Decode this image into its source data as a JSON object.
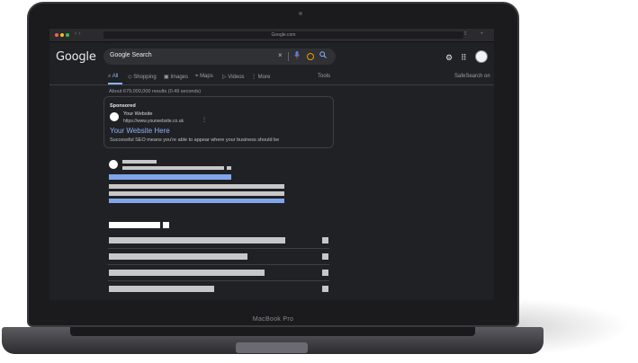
{
  "device": {
    "label": "MacBook Pro"
  },
  "browser": {
    "url": "Google.com",
    "arrows": "‹ ›",
    "bar_icons": "⇪ +"
  },
  "header": {
    "logo": "Google",
    "search_value": "Google Search",
    "clear_icon": "×",
    "mic_icon": "🎙",
    "search_icon": "⌕",
    "gear_icon": "⚙",
    "apps_icon": "⠿"
  },
  "tabs": [
    {
      "label": "All",
      "icon": "⌕"
    },
    {
      "label": "Shopping",
      "icon": "◇"
    },
    {
      "label": "Images",
      "icon": "▣"
    },
    {
      "label": "Maps",
      "icon": "⌖"
    },
    {
      "label": "Videos",
      "icon": "▷"
    },
    {
      "label": "More",
      "icon": "⋮"
    }
  ],
  "tools_label": "Tools",
  "safesearch_label": "SafeSearch on",
  "stats": "About 679,000,000 results (0.49 seconds)",
  "ad": {
    "sponsored": "Sponsored",
    "site_name": "Your Website",
    "site_url": "https://www.yourwebsite.co.uk",
    "more_icon": "⋮",
    "title": "Your Website Here",
    "description": "Successful SEO means you're able to appear where your business should be"
  }
}
